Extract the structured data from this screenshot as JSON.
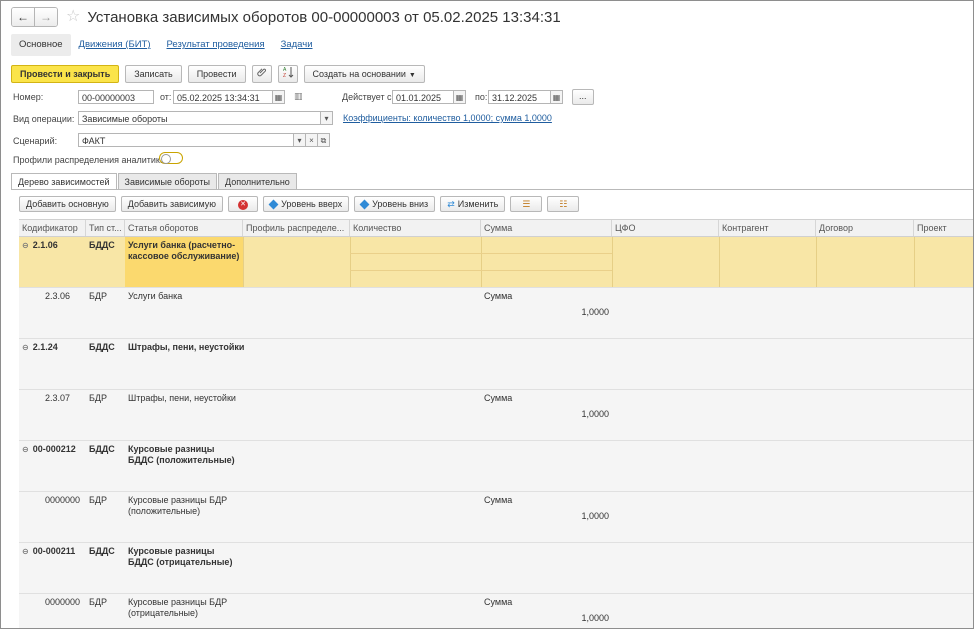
{
  "window": {
    "title": "Установка зависимых оборотов 00-00000003 от 05.02.2025 13:34:31"
  },
  "nav": {
    "back": "←",
    "forward": "→",
    "star": "☆"
  },
  "tabs": [
    "Основное",
    "Движения (БИТ)",
    "Результат проведения",
    "Задачи"
  ],
  "toolbar": {
    "post_close": "Провести и закрыть",
    "save": "Записать",
    "post": "Провести",
    "create_based": "Создать на основании"
  },
  "form": {
    "number_label": "Номер:",
    "number": "00-00000003",
    "date_label": "от:",
    "date": "05.02.2025 13:34:31",
    "valid_from_label": "Действует с:",
    "valid_from": "01.01.2025",
    "valid_to_label": "по:",
    "valid_to": "31.12.2025",
    "more": "...",
    "operation_label": "Вид операции:",
    "operation": "Зависимые обороты",
    "coefficients_link": "Коэффициенты: количество 1,0000; сумма 1,0000",
    "scenario_label": "Сценарий:",
    "scenario": "ФАКТ",
    "profiles_label": "Профили распределения аналитик:"
  },
  "inner_tabs": [
    "Дерево зависимостей",
    "Зависимые обороты",
    "Дополнительно"
  ],
  "table_toolbar": {
    "add_main": "Добавить основную",
    "add_dependent": "Добавить зависимую",
    "level_up": "Уровень вверх",
    "level_down": "Уровень вниз",
    "change": "Изменить"
  },
  "columns": [
    "Кодификатор",
    "Тип ст...",
    "Статья оборотов",
    "Профиль распределе...",
    "Количество",
    "Сумма",
    "ЦФО",
    "Контрагент",
    "Договор",
    "Проект"
  ],
  "rows": [
    {
      "code": "2.1.06",
      "type": "БДДС",
      "item": "Услуги банка (расчетно-кассовое обслуживание)",
      "sum_label": "",
      "value": ""
    },
    {
      "code": "2.3.06",
      "type": "БДР",
      "item": "Услуги банка",
      "sum_label": "Сумма",
      "value": "1,0000"
    },
    {
      "code": "2.1.24",
      "type": "БДДС",
      "item": "Штрафы, пени, неустойки",
      "sum_label": "",
      "value": ""
    },
    {
      "code": "2.3.07",
      "type": "БДР",
      "item": "Штрафы, пени, неустойки",
      "sum_label": "Сумма",
      "value": "1,0000"
    },
    {
      "code": "00-000212",
      "type": "БДДС",
      "item": "Курсовые разницы БДДС (положительные)",
      "sum_label": "",
      "value": ""
    },
    {
      "code": "0000000",
      "type": "БДР",
      "item": "Курсовые разницы БДР (положительные)",
      "sum_label": "Сумма",
      "value": "1,0000"
    },
    {
      "code": "00-000211",
      "type": "БДДС",
      "item": "Курсовые разницы БДДС (отрицательные)",
      "sum_label": "",
      "value": ""
    },
    {
      "code": "0000000",
      "type": "БДР",
      "item": "Курсовые разницы БДР (отрицательные)",
      "sum_label": "Сумма",
      "value": "1,0000"
    }
  ]
}
